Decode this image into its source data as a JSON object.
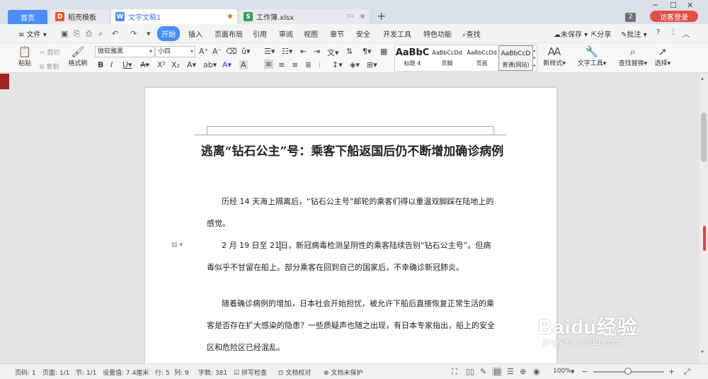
{
  "tabs": {
    "home": "首页",
    "templates": "稻壳模板",
    "doc": "文字文稿1",
    "xls": "工作簿.xlsx",
    "doc_icon": "W",
    "xls_icon": "S",
    "templates_icon": "D"
  },
  "titlebar": {
    "new_tab": "+",
    "count_badge": "2",
    "login": "访客登录"
  },
  "menu": {
    "file": "文件",
    "items": [
      "开始",
      "插入",
      "页面布局",
      "引用",
      "审阅",
      "视图",
      "章节",
      "安全",
      "开发工具",
      "特色功能"
    ],
    "search": "查找",
    "unsaved": "未保存",
    "share": "分享",
    "comment": "批注",
    "help": "?"
  },
  "ribbon": {
    "paste": "粘贴",
    "cut": "剪切",
    "copy": "复制",
    "format_painter": "格式刷",
    "font_name": "微软雅黑",
    "font_size": "小四",
    "styles": [
      {
        "preview": "AaBbC",
        "name": "标题 4"
      },
      {
        "preview": "AaBbCcDd",
        "name": "页脚"
      },
      {
        "preview": "AaBbCcDd",
        "name": "页眉"
      },
      {
        "preview": "AaBbCcD",
        "name": "普通(网站)"
      }
    ],
    "new_style": "新样式",
    "text_tools": "文字工具",
    "find_replace": "查找替换",
    "select": "选择"
  },
  "document": {
    "title": "逃离“钻石公主”号：乘客下船返国后仍不断增加确诊病例",
    "p1": "历经 14 天海上隔离后，“钻石公主号”邮轮的乘客们得以重温双脚踩在陆地上的感觉。",
    "p2_a": "2 月 19 日至 21",
    "p2_b": "日，新冠病毒检测呈阴性的乘客陆续告别“钻石公主号”。但病毒似乎不甘留在船上。部分乘客在回到自己的国家后，不幸确诊新冠肺炎。",
    "p3": "随着确诊病例的增加，日本社会开始担忧，被允许下船后直接恢复正常生活的乘客是否存在扩大感染的隐患？一些质疑声也随之出现，有日本专家指出，船上的安全区和危险区已经混乱。"
  },
  "status": {
    "page_num": "页码: 1",
    "pages": "页面: 1/1",
    "section": "节: 1/1",
    "setting": "设置值: 7.4厘米",
    "row": "行: 5",
    "col": "列: 9",
    "words": "字数: 381",
    "spell": "拼写检查",
    "proof": "文档校对",
    "protect": "文档未保护",
    "zoom": "100%"
  },
  "watermark": {
    "brand": "Baidu经验",
    "url": "jingyan.baidu.com"
  },
  "colors": {
    "accent": "#4a8ef5",
    "login": "#e0504a",
    "doc_tab_text": "#3f74d9"
  }
}
